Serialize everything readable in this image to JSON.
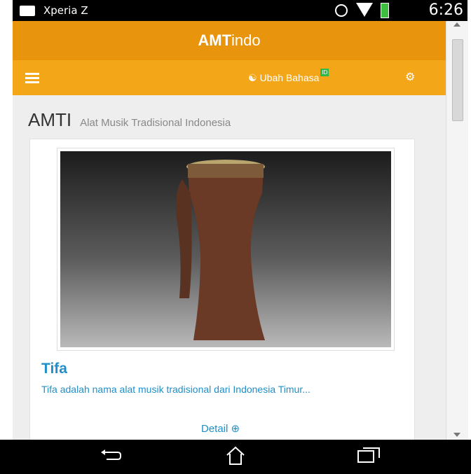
{
  "status_bar": {
    "carrier": "Xperia Z",
    "time": "6:26"
  },
  "app": {
    "title_bold": "AMT",
    "title_rest": "indo"
  },
  "navbar": {
    "language_label": "Ubah Bahasa",
    "language_badge": "ID"
  },
  "header": {
    "title": "AMTI",
    "subtitle": "Alat Musik Tradisional Indonesia"
  },
  "item": {
    "name": "Tifa",
    "description": "Tifa adalah nama alat musik tradisional dari Indonesia Timur...",
    "detail_label": "Detail"
  },
  "colors": {
    "app_bar": "#e8940d",
    "nav_bar": "#f3a618",
    "link": "#1f8fc9",
    "badge": "#2db84a"
  }
}
